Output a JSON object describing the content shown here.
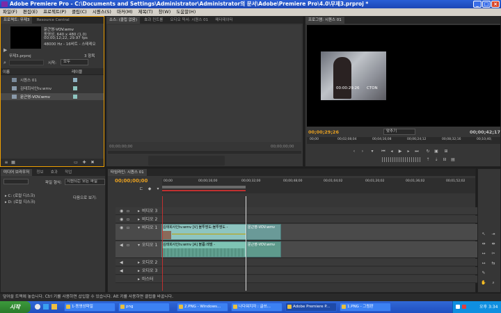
{
  "window": {
    "title": "Adobe Premiere Pro - C:\\Documents and Settings\\Administrator\\Administrator의 문서\\Adobe\\Premiere Pro\\4.0\\무제3.prproj *"
  },
  "menu": [
    "파일(F)",
    "편집(E)",
    "프로젝트(P)",
    "클립(C)",
    "시퀀스(S)",
    "마커(M)",
    "제목(T)",
    "창(W)",
    "도움말(H)"
  ],
  "project": {
    "tabs": [
      "프로젝트: 무제3",
      "Resource Central"
    ],
    "clip_name": "문근영-VOV.wmv",
    "clip_type": "동영상, 640 x 480 (1.0)",
    "clip_duration": "00;00;12;22, 29.97 fps",
    "clip_audio": "48000 Hz - 16비트 - 스테레오",
    "project_file": "무제3.prproj",
    "item_count": "3 항목",
    "in_label": "시작:",
    "in_value": "모두",
    "col_name": "이름",
    "col_label": "레이블",
    "items": [
      "시퀀스 01",
      "김태희사인tv.wmv",
      "문근영-VOV.wmv"
    ]
  },
  "source": {
    "tabs": [
      "소스: (클립 없음)",
      "효과 컨트롤",
      "오디오 믹서: 시퀀스 01",
      "메타데이터"
    ],
    "timecode": "00;00;00;00",
    "timecode_right": "00;00;00;00"
  },
  "program": {
    "tab": "프로그램: 시퀀스 01",
    "timecode": "00;00;29;26",
    "fit": "맞추기",
    "duration": "00;00;42;17",
    "ruler": [
      "00;00",
      "00;02;08;04",
      "00;04;16;08",
      "00;06;24;12",
      "00;08;32;16",
      "00;10;40;"
    ],
    "overlay": "00:00:29:26",
    "brand": "CTON"
  },
  "browser": {
    "tabs": [
      "미디어 브라우저",
      "정보",
      "효과",
      "작업"
    ],
    "view_label": "파일 형식:",
    "view_value": "지원되는 모든 파일",
    "drives": [
      "C: (로컬 디스크)",
      "D: (로컬 디스크)"
    ],
    "view_as": "다음으로 보기:"
  },
  "timeline": {
    "tab": "타임라인: 시퀀스 01",
    "timecode": "00;00;00;00",
    "ruler": [
      "00;00",
      "00;00;16;00",
      "00;00;32;00",
      "00;00;48;00",
      "00;01;04;02",
      "00;01;20;02",
      "00;01;36;02",
      "00;01;52;02"
    ],
    "video_tracks": [
      "비디오 3",
      "비디오 2",
      "비디오 1"
    ],
    "audio_tracks": [
      "오디오 1",
      "오디오 2",
      "오디오 3",
      "마스터"
    ],
    "clip_v1a": "김태희사인tv.wmv [V]  불투명도:불투명도 -",
    "clip_v1b": "문근영-VOV.wmv",
    "clip_a1a": "김태희사인tv.wmv [A]  볼륨:레벨 -",
    "clip_a1b": "문근영-VOV.wmv"
  },
  "status": "덮어쓸 트랙에 놓습니다. Ctrl 키를 사용하면 삽입할 수 있습니다. Alt 키를 사용하면 클립을 바꿉니다.",
  "taskbar": {
    "start": "시작",
    "items": [
      "1-동영상파일",
      "png",
      "2.PNG - Windows...",
      "나다워지자 : 글쓰...",
      "Adobe Premiere P...",
      "1.PNG - 그림판"
    ],
    "clock": "오후 3:34"
  },
  "colors": {
    "accent": "#f0a000",
    "timecode": "#e8a020",
    "clip_video": "#8ec5c0",
    "clip_audio": "#7ec4b4",
    "taskbar": "#245edb"
  }
}
